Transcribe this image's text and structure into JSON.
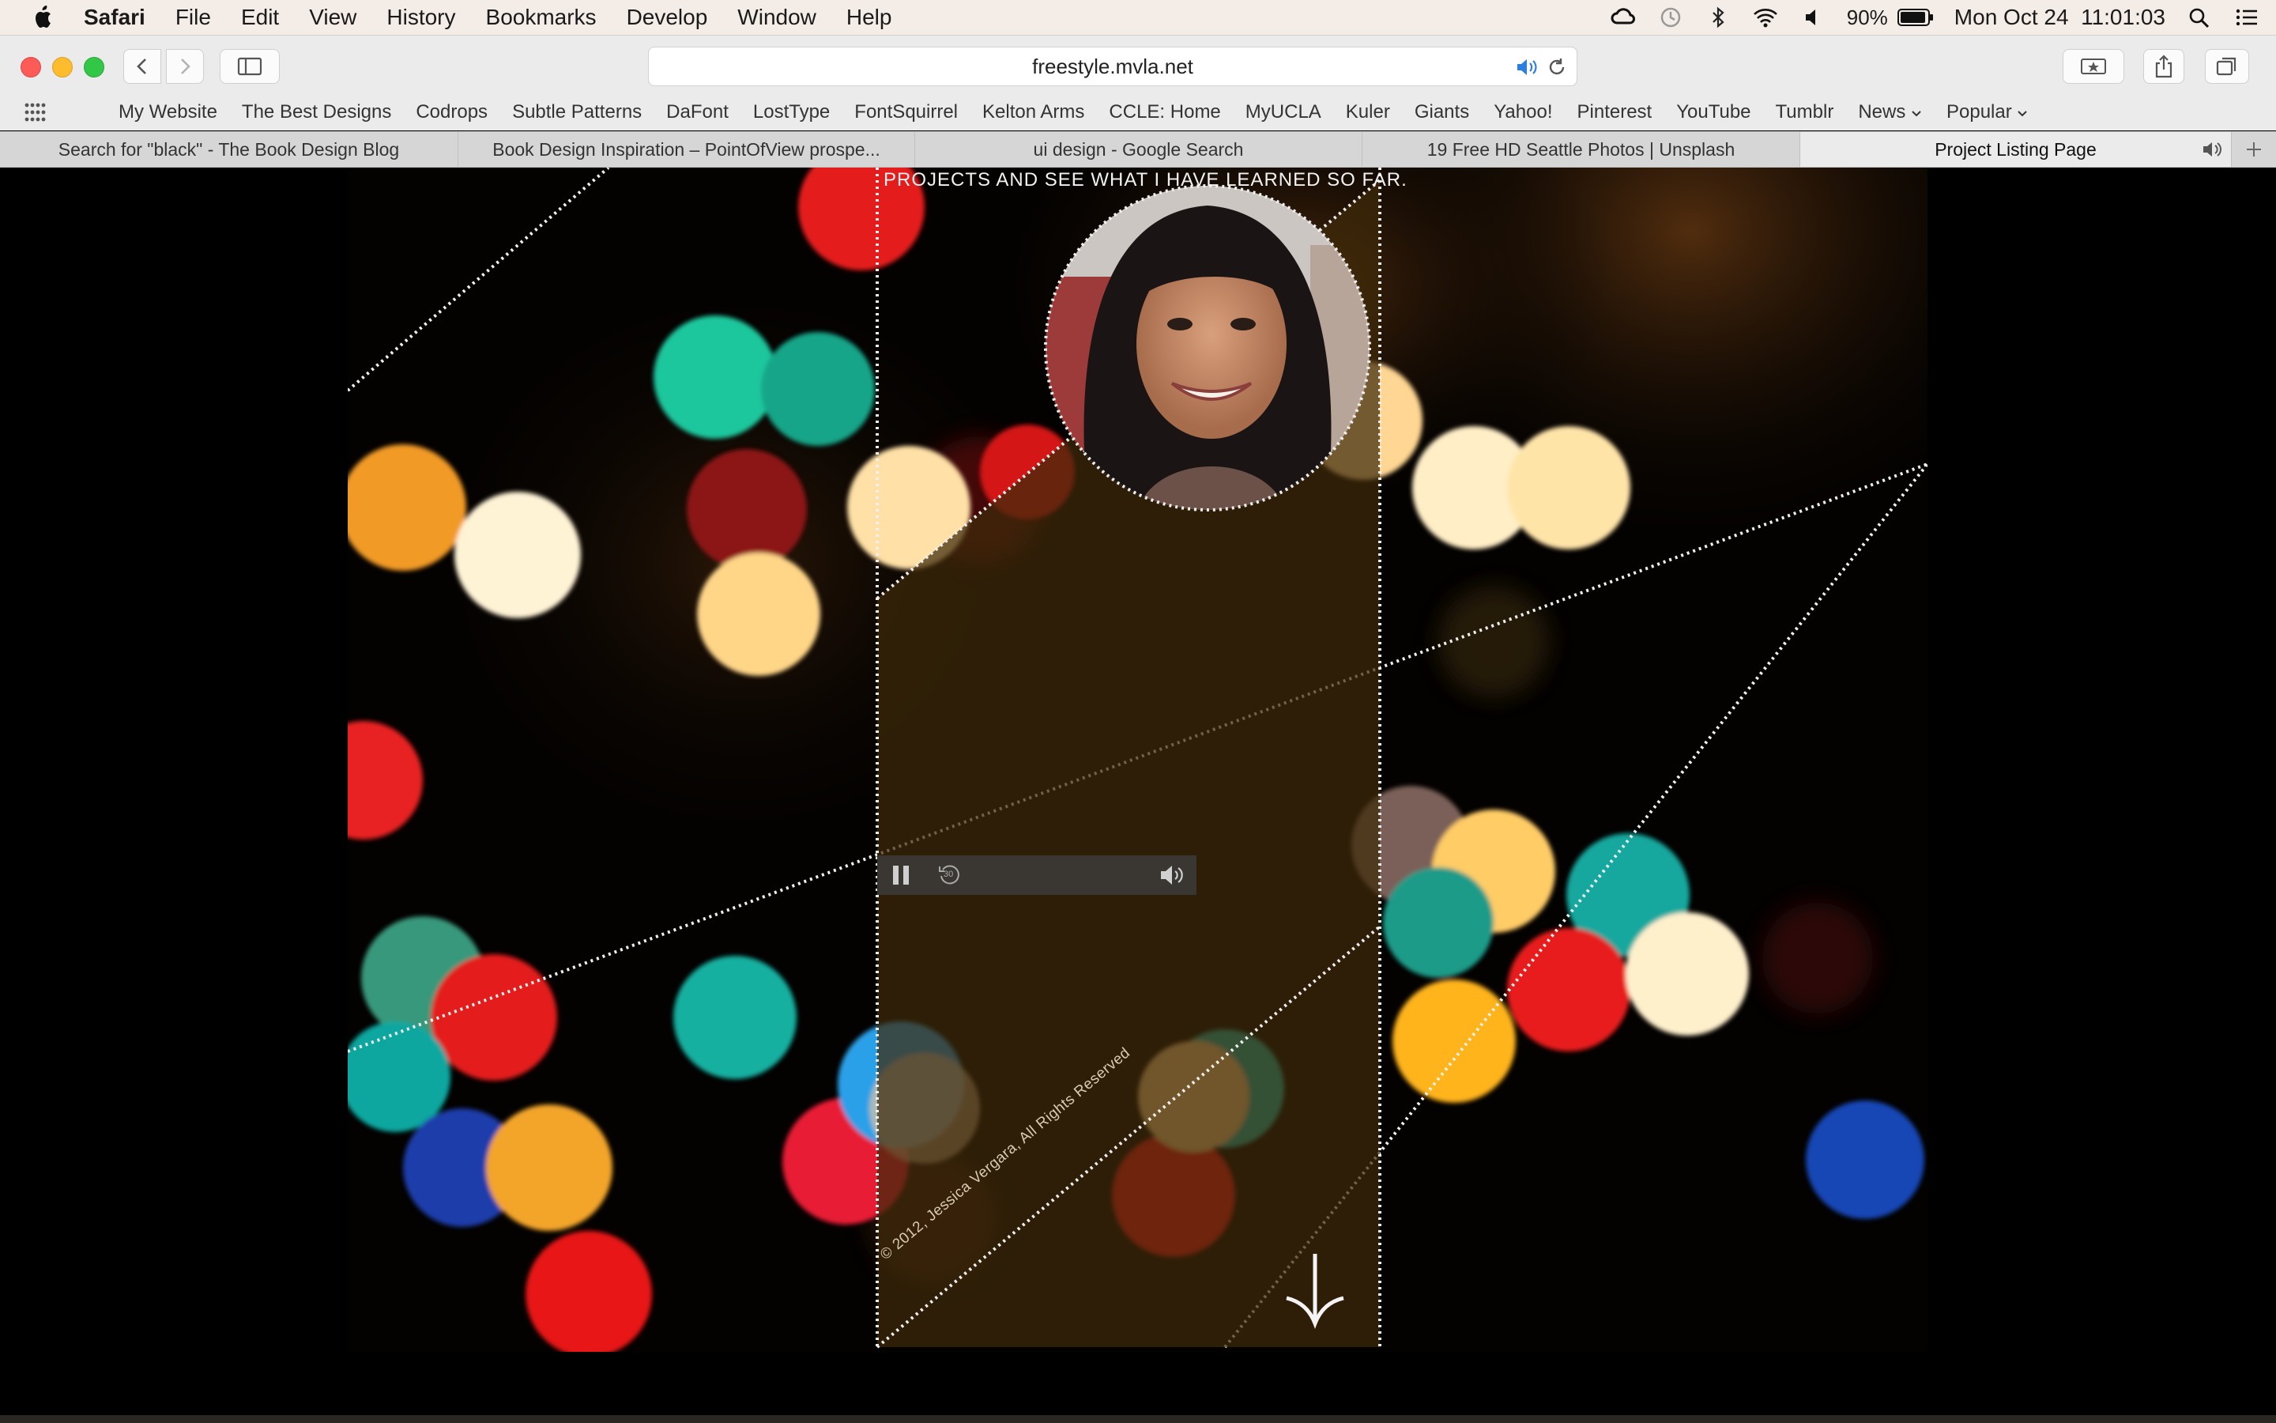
{
  "menubar": {
    "app_name": "Safari",
    "items": [
      "File",
      "Edit",
      "View",
      "History",
      "Bookmarks",
      "Develop",
      "Window",
      "Help"
    ],
    "battery": "90%",
    "datetime": "Mon Oct 24  11:01:03"
  },
  "browser": {
    "url": "freestyle.mvla.net",
    "bookmarks": [
      "My Website",
      "The Best Designs",
      "Codrops",
      "Subtle Patterns",
      "DaFont",
      "LostType",
      "FontSquirrel",
      "Kelton Arms",
      "CCLE: Home",
      "MyUCLA",
      "Kuler",
      "Giants",
      "Yahoo!",
      "Pinterest",
      "YouTube",
      "Tumblr"
    ],
    "bookmark_folders": [
      "News",
      "Popular"
    ],
    "tabs": [
      "Search for \"black\" - The Book Design Blog",
      "Book Design Inspiration – PointOfView prospe...",
      "ui design - Google Search",
      "19 Free HD Seattle Photos | Unsplash",
      "Project Listing Page"
    ],
    "active_tab_index": 4
  },
  "page": {
    "banner_text": "projects and see what I have learned so far.",
    "copyright": "© 2012, Jessica Vergara, All Rights Reserved",
    "audio_player": {
      "pause_icon": "pause-icon",
      "skip_back_label": "30",
      "volume_icon": "speaker-icon"
    },
    "scroll_icon": "arrow-down-icon"
  },
  "colors": {
    "menubar_bg": "#f4ece6",
    "chrome_bg": "#ebebeb",
    "accent_audio": "#2a7fe0",
    "overlay_panel": "#3e2a0a"
  }
}
